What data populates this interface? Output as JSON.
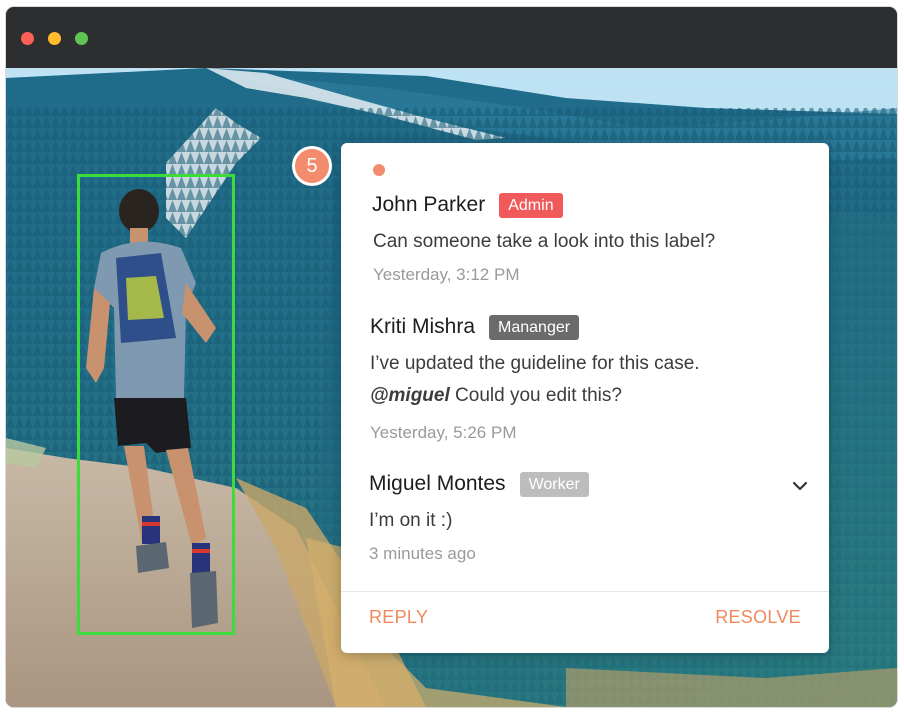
{
  "window": {
    "controls": [
      "red",
      "yellow",
      "green"
    ],
    "control_colors": {
      "close": "#fe5f57",
      "minimize": "#febc2e",
      "maximize": "#5fc454"
    }
  },
  "annotation": {
    "bbox_color": "#3ddc3a",
    "comment_count": "5"
  },
  "comments": [
    {
      "author": "John Parker",
      "role": "Admin",
      "role_color": "#f05a5a",
      "text": "Can someone take a look into this label?",
      "time": "Yesterday, 3:12 PM"
    },
    {
      "author": "Kriti Mishra",
      "role": "Mananger",
      "role_color": "#6b6b6b",
      "text_line1": "I’ve updated the guideline for this case.",
      "mention": "@miguel",
      "text_line2_rest": " Could you edit this?",
      "time": "Yesterday, 5:26 PM"
    },
    {
      "author": "Miguel Montes",
      "role": "Worker",
      "role_color": "#bdbdbd",
      "text": "I’m on it :)",
      "time": "3 minutes ago",
      "expand_icon": "chevron-down-icon"
    }
  ],
  "actions": {
    "reply_label": "REPLY",
    "resolve_label": "RESOLVE",
    "color": "#ef8a5e"
  },
  "accent": {
    "unread_dot": "#f28c6c"
  }
}
